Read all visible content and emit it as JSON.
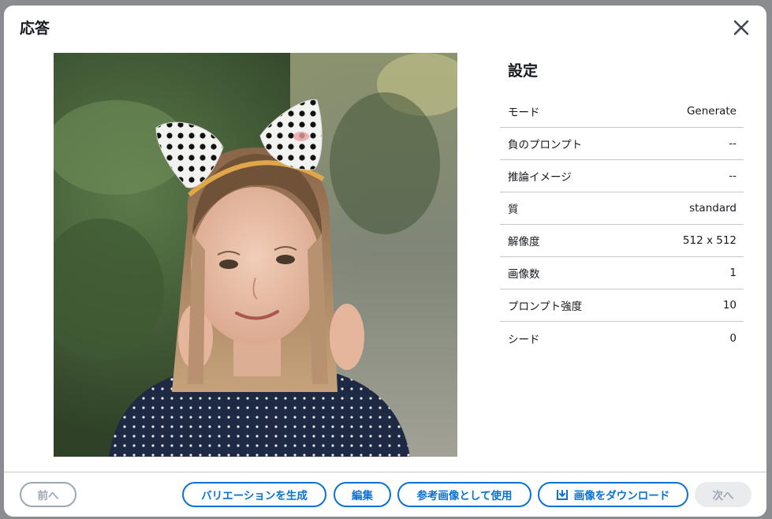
{
  "modal": {
    "title": "応答"
  },
  "settings": {
    "title": "設定",
    "rows": [
      {
        "label": "モード",
        "value": "Generate"
      },
      {
        "label": "負のプロンプト",
        "value": "--"
      },
      {
        "label": "推論イメージ",
        "value": "--"
      },
      {
        "label": "質",
        "value": "standard"
      },
      {
        "label": "解像度",
        "value": "512 x 512"
      },
      {
        "label": "画像数",
        "value": "1"
      },
      {
        "label": "プロンプト強度",
        "value": "10"
      },
      {
        "label": "シード",
        "value": "0"
      }
    ]
  },
  "footer": {
    "prev_label": "前へ",
    "variation_label": "バリエーションを生成",
    "edit_label": "編集",
    "reference_label": "参考画像として使用",
    "download_label": "画像をダウンロード",
    "next_label": "次へ"
  },
  "colors": {
    "accent": "#0972d3",
    "disabled": "#9ba7b6",
    "divider": "#c6c6cd"
  },
  "icons": {
    "close": "close-icon",
    "download": "download-icon"
  }
}
